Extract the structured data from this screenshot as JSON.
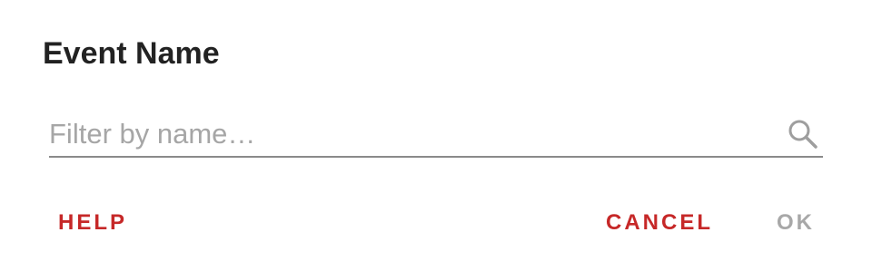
{
  "dialog": {
    "title": "Event Name",
    "search": {
      "placeholder": "Filter by name…",
      "value": "",
      "icon": "search-icon"
    },
    "buttons": {
      "help_label": "HELP",
      "cancel_label": "CANCEL",
      "ok_label": "OK"
    },
    "colors": {
      "accent": "#c62828",
      "disabled": "#a8a8a8",
      "title": "#222222"
    }
  }
}
